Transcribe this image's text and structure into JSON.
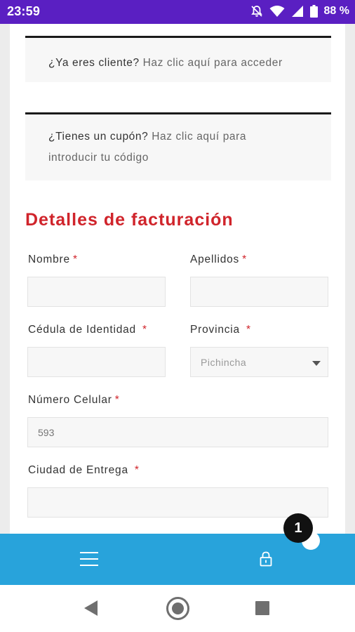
{
  "status_bar": {
    "time": "23:59",
    "battery": "88 %",
    "icons": [
      "notifications-off-icon",
      "wifi-icon",
      "signal-icon",
      "battery-icon"
    ]
  },
  "notices": {
    "login": {
      "question": "¿Ya eres cliente?",
      "link": "Haz clic aquí para acceder"
    },
    "coupon": {
      "question": "¿Tienes un cupón?",
      "link_line1": "Haz clic aquí para",
      "link_line2": "introducir tu código"
    }
  },
  "billing": {
    "title": "Detalles de facturación",
    "required_mark": "*",
    "fields": {
      "nombre": {
        "label": "Nombre",
        "value": ""
      },
      "apellidos": {
        "label": "Apellidos",
        "value": ""
      },
      "cedula": {
        "label": "Cédula de Identidad",
        "value": ""
      },
      "provincia": {
        "label": "Provincia",
        "value": "Pichincha"
      },
      "celular": {
        "label": "Número Celular",
        "placeholder": "593"
      },
      "ciudad": {
        "label": "Ciudad de Entrega",
        "value": ""
      }
    }
  },
  "app_bar": {
    "menu_icon": "hamburger-icon",
    "lock_icon": "lock-icon",
    "badge_count": "1"
  },
  "colors": {
    "status_bar": "#5a1fc2",
    "accent_red": "#d0242b",
    "app_bar": "#28a3db"
  }
}
